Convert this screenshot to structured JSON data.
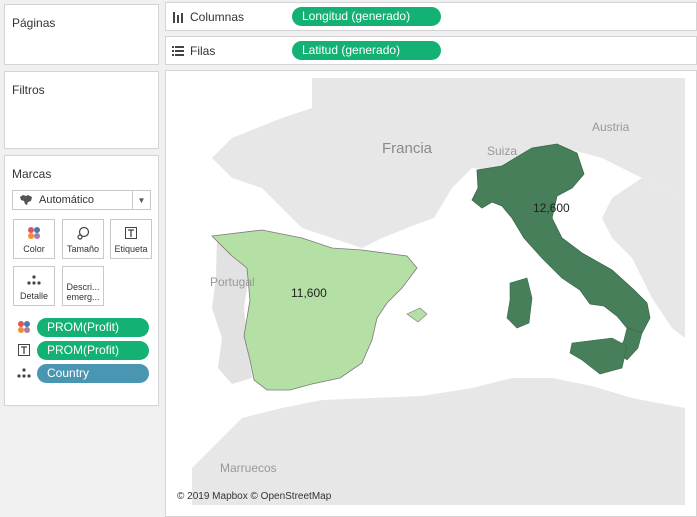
{
  "panels": {
    "pages_title": "Páginas",
    "filters_title": "Filtros",
    "marks_title": "Marcas"
  },
  "shelves": {
    "columns_label": "Columnas",
    "columns_pill": "Longitud (generado)",
    "rows_label": "Filas",
    "rows_pill": "Latitud (generado)"
  },
  "marks": {
    "type": "Automático",
    "buttons": {
      "color": "Color",
      "size": "Tamaño",
      "label": "Etiqueta",
      "detail": "Detalle",
      "tooltip": "Descri... emerg..."
    },
    "fields": [
      {
        "label": "PROM(Profit)",
        "encoding": "color"
      },
      {
        "label": "PROM(Profit)",
        "encoding": "label"
      },
      {
        "label": "Country",
        "encoding": "detail"
      }
    ]
  },
  "map": {
    "labels": {
      "francia": "Francia",
      "portugal": "Portugal",
      "suiza": "Suiza",
      "austria": "Austria",
      "marruecos": "Marruecos"
    },
    "values": [
      {
        "country": "Spain",
        "value": "11,600",
        "color": "#b5e0a5"
      },
      {
        "country": "Italy",
        "value": "12,600",
        "color": "#477f5a"
      }
    ],
    "attribution": "© 2019 Mapbox © OpenStreetMap"
  },
  "colors": {
    "pill_green": "#13b173",
    "pill_blue": "#4996b2",
    "spain_fill": "#b5e0a5",
    "italy_fill": "#477f5a"
  }
}
